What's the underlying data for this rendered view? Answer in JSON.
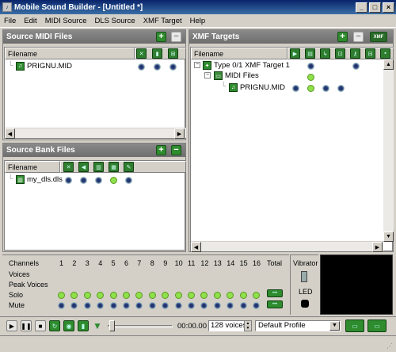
{
  "window": {
    "title": "Mobile Sound Builder - [Untitled *]",
    "app_icon": "app-icon"
  },
  "menu": [
    "File",
    "Edit",
    "MIDI Source",
    "DLS Source",
    "XMF Target",
    "Help"
  ],
  "source_midi": {
    "title": "Source MIDI Files",
    "column_filename": "Filename",
    "files": [
      {
        "name": "PRIGNU.MID"
      }
    ]
  },
  "source_bank": {
    "title": "Source Bank Files",
    "column_filename": "Filename",
    "files": [
      {
        "name": "my_dls.dls"
      }
    ]
  },
  "xmf_targets": {
    "title": "XMF Targets",
    "column_filename": "Filename",
    "xmf_label": "XMF",
    "tree": {
      "target": "Type 0/1 XMF Target 1",
      "folder": "MIDI Files",
      "file": "PRIGNU.MID"
    }
  },
  "mixer": {
    "channels_label": "Channels",
    "voices_label": "Voices",
    "peak_voices_label": "Peak Voices",
    "solo_label": "Solo",
    "mute_label": "Mute",
    "total_label": "Total",
    "channels": [
      "1",
      "2",
      "3",
      "4",
      "5",
      "6",
      "7",
      "8",
      "9",
      "10",
      "11",
      "12",
      "13",
      "14",
      "15",
      "16"
    ]
  },
  "vibrator": {
    "label": "Vibrator",
    "led_label": "LED"
  },
  "transport": {
    "time": "00:00.00",
    "voices_select": "128 voices",
    "profile_select": "Default Profile"
  },
  "colors": {
    "accent_green": "#2e8b2e",
    "dot_navy": "#23346b",
    "solo_green": "#8fe04a"
  }
}
